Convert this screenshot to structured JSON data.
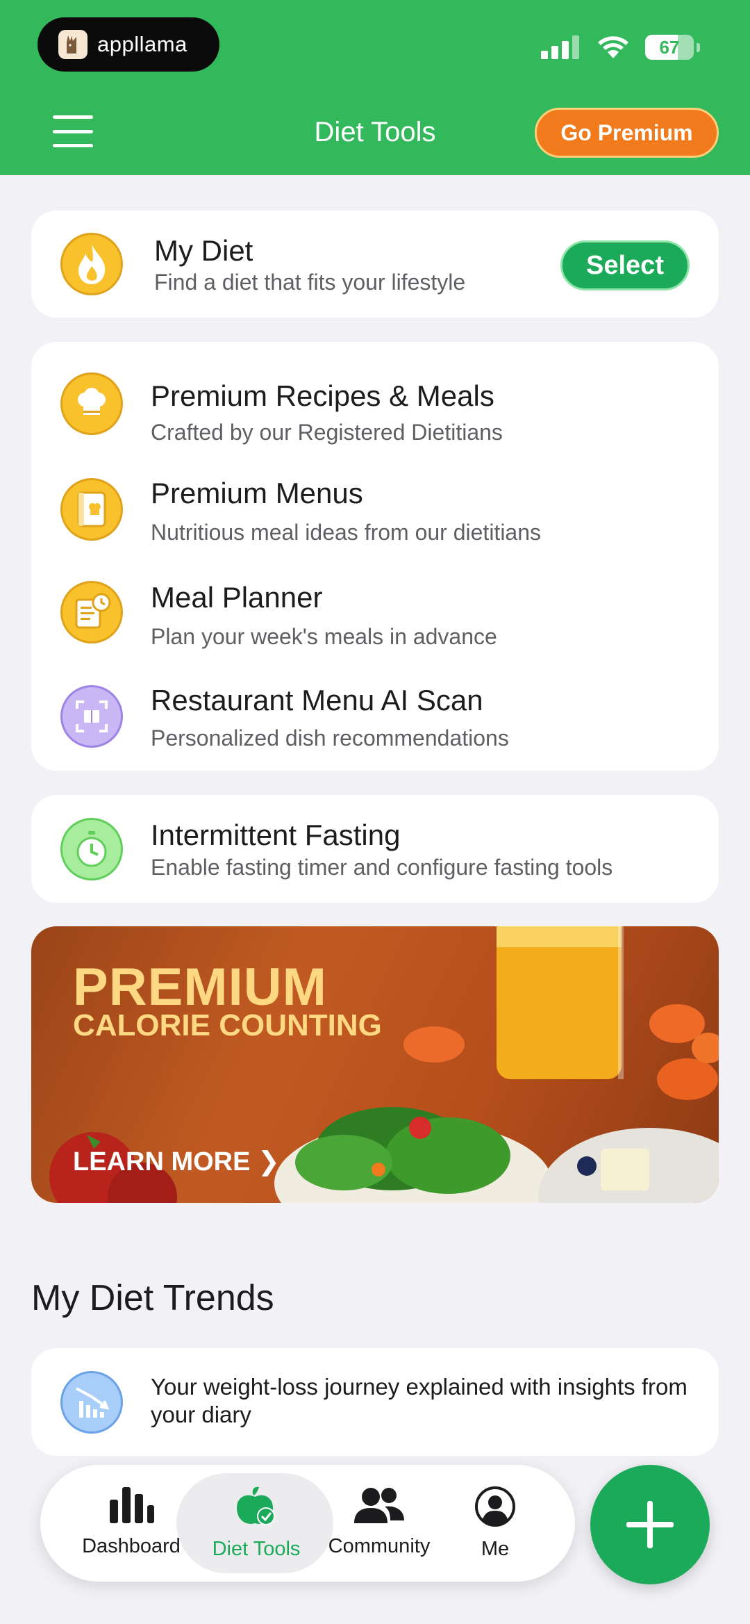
{
  "status_bar": {
    "app_name": "appllama",
    "battery": "67"
  },
  "header": {
    "title": "Diet Tools",
    "premium_button": "Go Premium"
  },
  "my_diet": {
    "title": "My Diet",
    "subtitle": "Find a diet that fits your lifestyle",
    "button": "Select",
    "icon": "flame-icon"
  },
  "premium_tools": [
    {
      "title": "Premium Recipes & Meals",
      "subtitle": "Crafted by our Registered Dietitians",
      "icon": "chef-hat-icon"
    },
    {
      "title": "Premium Menus",
      "subtitle": "Nutritious meal ideas from our dietitians",
      "icon": "menu-book-icon"
    },
    {
      "title": "Meal Planner",
      "subtitle": "Plan your week's meals in advance",
      "icon": "planner-clock-icon"
    },
    {
      "title": "Restaurant Menu AI Scan",
      "subtitle": "Personalized dish recommendations",
      "icon": "scan-icon"
    }
  ],
  "fasting": {
    "title": "Intermittent Fasting",
    "subtitle": "Enable fasting timer and configure fasting tools",
    "icon": "stopwatch-icon"
  },
  "banner": {
    "line1": "PREMIUM",
    "line2": "CALORIE COUNTING",
    "cta": "LEARN MORE ❯"
  },
  "trends": {
    "section_title": "My Diet Trends",
    "card_text": "Your weight-loss journey explained with insights from your diary"
  },
  "nav": {
    "items": [
      "Dashboard",
      "Diet Tools",
      "Community",
      "Me"
    ],
    "active": "Diet Tools"
  },
  "colors": {
    "brand_green": "#34b85c",
    "accent_orange": "#f07a1c",
    "button_green": "#1aaa5a"
  }
}
